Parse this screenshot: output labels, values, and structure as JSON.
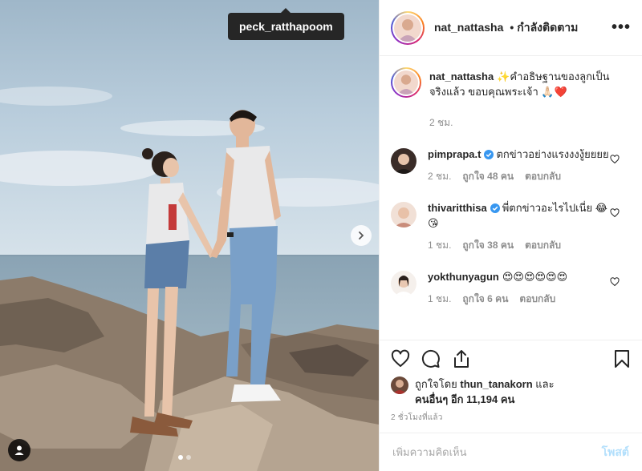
{
  "photo": {
    "tag_label": "peck_ratthapoom",
    "carousel_dots": 2,
    "active_dot": 1
  },
  "header": {
    "username": "nat_nattasha",
    "separator": "•",
    "follow_status": "กำลังติดตาม",
    "more_icon": "more-horizontal-icon"
  },
  "caption": {
    "username": "nat_nattasha",
    "text": "✨คำอธิษฐานของลูกเป็นจริงแล้ว ขอบคุณพระเจ้า 🙏🏻❤️",
    "time": "2 ชม."
  },
  "comments": [
    {
      "username": "pimprapa.t",
      "verified": true,
      "text": "ตกข่าวอย่างแรงงงงู้ยยยย",
      "time": "2 ชม.",
      "likes": "ถูกใจ 48 คน",
      "reply": "ตอบกลับ"
    },
    {
      "username": "thivaritthisa",
      "verified": true,
      "text": "พี่ตกข่าวอะไรไปเนี่ย 😂😘",
      "time": "1 ชม.",
      "likes": "ถูกใจ 38 คน",
      "reply": "ตอบกลับ"
    },
    {
      "username": "yokthunyagun",
      "verified": false,
      "text": "😍😍😍😍😍😍",
      "time": "1 ชม.",
      "likes": "ถูกใจ 6 คน",
      "reply": "ตอบกลับ"
    }
  ],
  "likes": {
    "prefix": "ถูกใจโดย",
    "user": "thun_tanakorn",
    "and": "และ",
    "others": "คนอื่นๆ อีก 11,194 คน"
  },
  "timestamp": "2 ชั่วโมงที่แล้ว",
  "add_comment": {
    "placeholder": "เพิ่มความคิดเห็น",
    "post_label": "โพสต์"
  },
  "colors": {
    "text": "#262626",
    "muted": "#8e8e8e",
    "verified": "#3897f0",
    "like_red": "#ed4956",
    "post_disabled": "#b2dffc"
  }
}
